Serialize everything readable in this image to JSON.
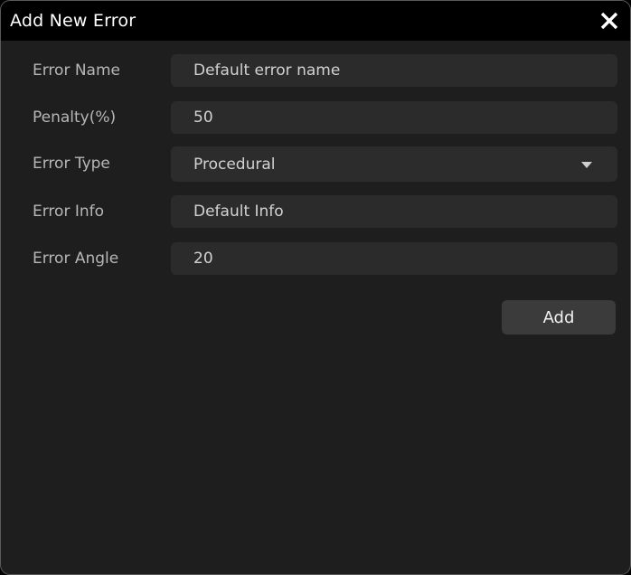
{
  "dialog": {
    "title": "Add New Error",
    "close_icon": "close-icon",
    "colors": {
      "titlebar_background": "#000000",
      "dialog_background": "#1e1e1e",
      "field_background": "#2b2b2b",
      "button_background": "#3b3b3b",
      "label_text": "#b7b7b7",
      "value_text": "#d2d2d2",
      "title_text": "#ffffff",
      "border": "#5a5a5a"
    }
  },
  "form": {
    "fields": [
      {
        "label": "Error Name",
        "value": "Default error name",
        "placeholder": "Default error name",
        "type": "text"
      },
      {
        "label": "Penalty(%)",
        "value": "50",
        "placeholder": "50",
        "type": "text"
      },
      {
        "label": "Error Type",
        "value": "Procedural",
        "placeholder": "Procedural",
        "type": "select",
        "chevron_icon": "chevron-down-icon"
      },
      {
        "label": "Error Info",
        "value": "Default Info",
        "placeholder": "Default Info",
        "type": "text"
      },
      {
        "label": "Error Angle",
        "value": "20",
        "placeholder": "20",
        "type": "text"
      }
    ]
  },
  "actions": {
    "add_label": "Add"
  }
}
